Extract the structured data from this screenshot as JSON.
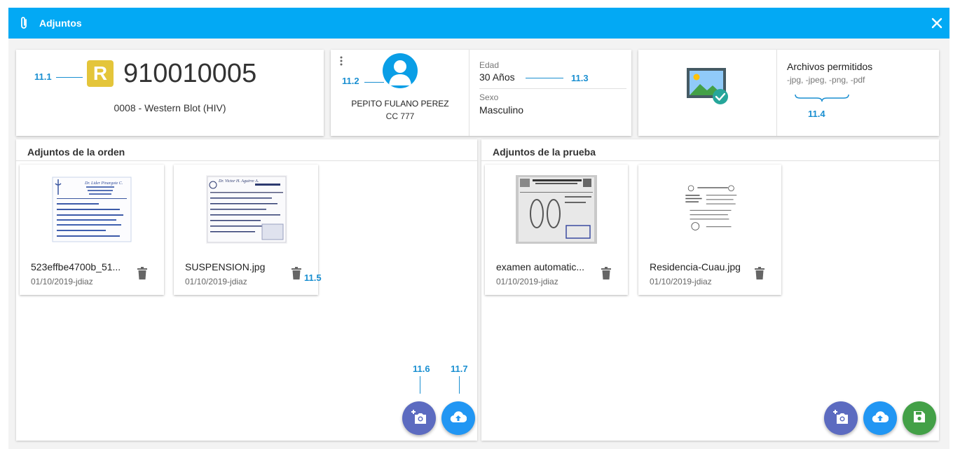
{
  "header": {
    "title": "Adjuntos",
    "close_icon": "close-icon",
    "attach_icon": "paperclip-icon"
  },
  "colors": {
    "header": "#03a9f4",
    "badge": "#e4c53a",
    "annotation": "#1a8fd1",
    "fab_camera": "#5c6bc0",
    "fab_upload": "#2196f3",
    "fab_save": "#43a047"
  },
  "order": {
    "badge": "R",
    "number": "910010005",
    "study": "0008 - Western Blot (HIV)"
  },
  "patient": {
    "name": "PEPITO FULANO PEREZ",
    "document": "CC 777"
  },
  "demographics": {
    "age_label": "Edad",
    "age_value": "30 Años",
    "sex_label": "Sexo",
    "sex_value": "Masculino"
  },
  "permitted": {
    "title": "Archivos permitidos",
    "formats": "-jpg, -jpeg, -png, -pdf"
  },
  "annotations": {
    "a1": "11.1",
    "a2": "11.2",
    "a3": "11.3",
    "a4": "11.4",
    "a5": "11.5",
    "a6": "11.6",
    "a7": "11.7"
  },
  "order_panel": {
    "title": "Adjuntos de la orden",
    "files": [
      {
        "name": "523effbe4700b_51...",
        "meta": "01/10/2019-jdiaz"
      },
      {
        "name": "SUSPENSION.jpg",
        "meta": "01/10/2019-jdiaz"
      }
    ]
  },
  "test_panel": {
    "title": "Adjuntos de la prueba",
    "files": [
      {
        "name": "examen automatic...",
        "meta": "01/10/2019-jdiaz"
      },
      {
        "name": "Residencia-Cuau.jpg",
        "meta": "01/10/2019-jdiaz"
      }
    ]
  }
}
